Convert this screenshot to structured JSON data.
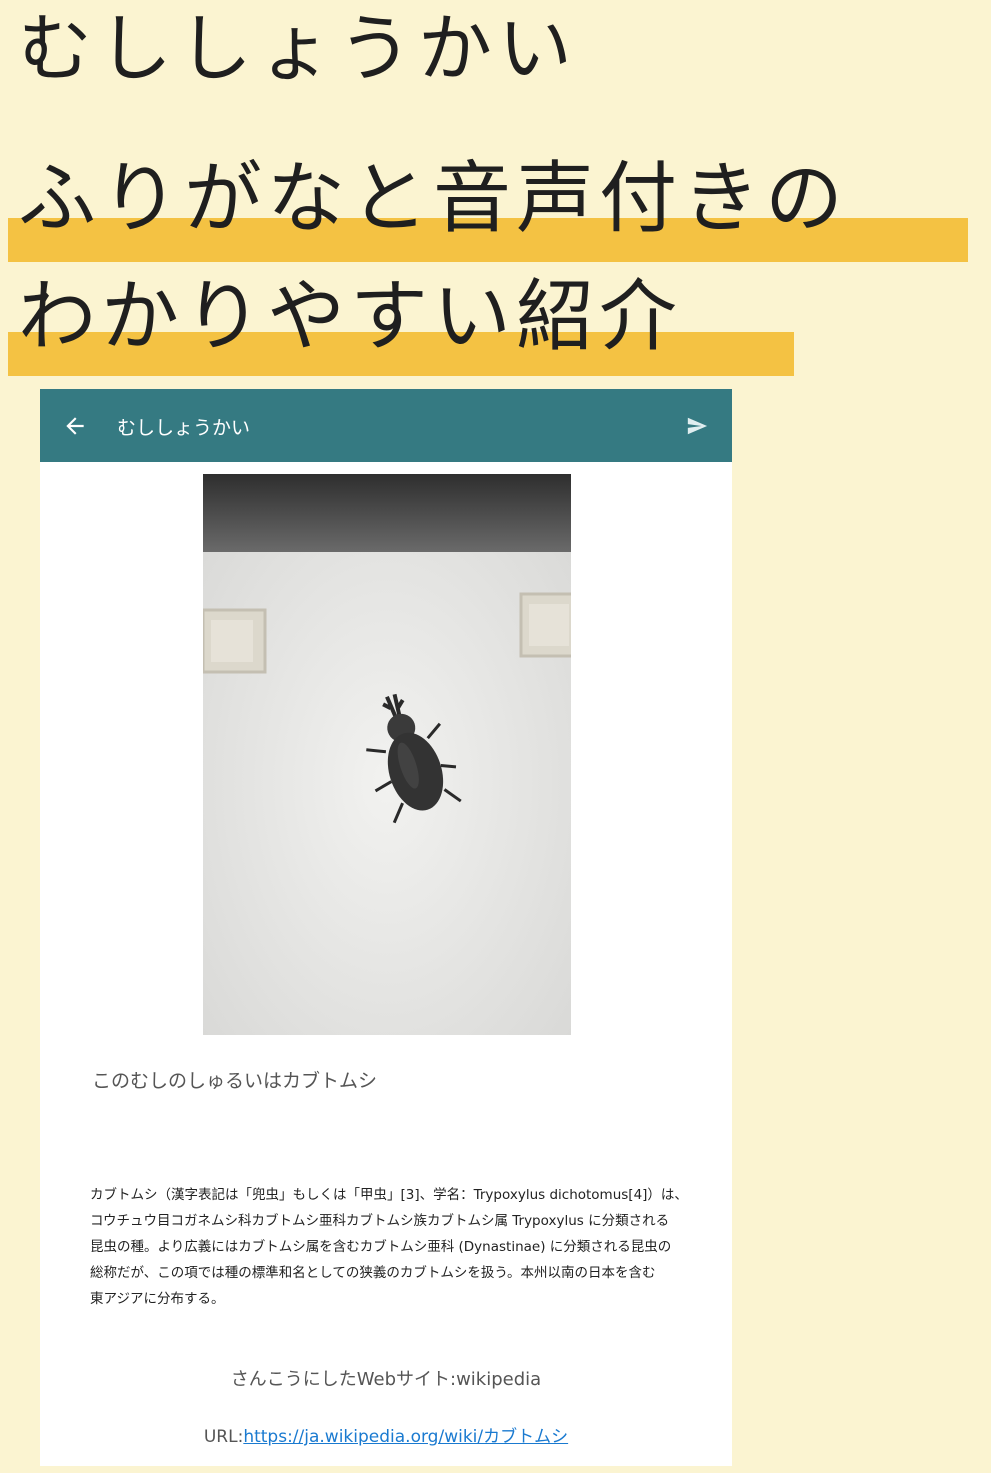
{
  "page": {
    "title": "むししょうかい",
    "subtitle_line1": "ふりがなと音声付きの",
    "subtitle_line2": "わかりやすい紹介"
  },
  "colors": {
    "background": "#fbf4d1",
    "highlight": "#f4c243",
    "appbar": "#357a82",
    "link": "#1a7ad0"
  },
  "app": {
    "appbar": {
      "back_icon": "arrow-left-icon",
      "title": "むししょうかい",
      "send_icon": "send-icon"
    },
    "photo": {
      "subject": "beetle-photo"
    },
    "species_text": "このむしのしゅるいはカブトムシ",
    "description_lines": [
      "カブトムシ（漢字表記は「兜虫」もしくは「甲虫」[3]、学名：Trypoxylus dichotomus[4]）は、",
      "コウチュウ目コガネムシ科カブトムシ亜科カブトムシ族カブトムシ属 Trypoxylus に分類される",
      "昆虫の種。より広義にはカブトムシ属を含むカブトムシ亜科 (Dynastinae) に分類される昆虫の",
      "総称だが、この項では種の標準和名としての狭義のカブトムシを扱う。本州以南の日本を含む",
      "東アジアに分布する。"
    ],
    "reference_site": "さんこうにしたWebサイト:wikipedia",
    "url_label": "URL:",
    "url_link": "https://ja.wikipedia.org/wiki/カブトムシ"
  }
}
